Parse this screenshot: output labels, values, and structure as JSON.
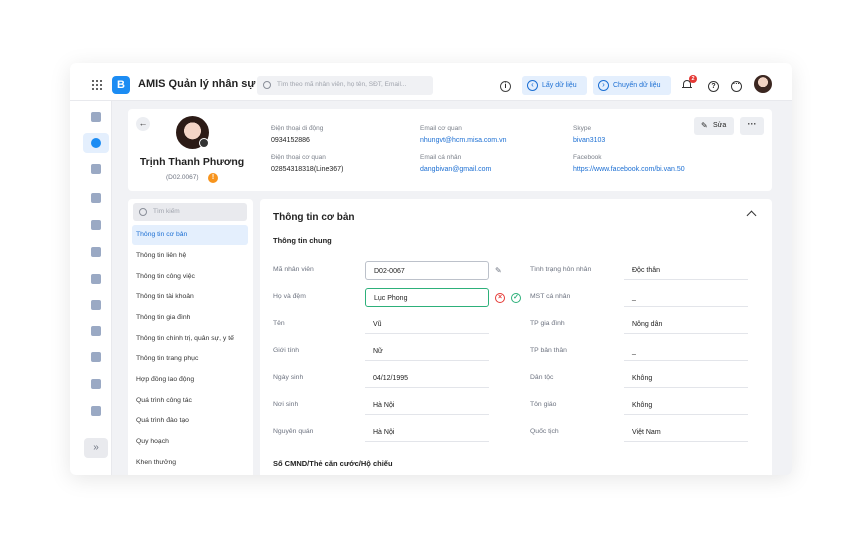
{
  "app": {
    "title": "AMIS Quản lý nhân sự",
    "logo_letter": "B",
    "search_placeholder": "Tìm theo mã nhân viên, họ tên, SĐT, Email...",
    "get_data_label": "Lấy dữ liệu",
    "transfer_data_label": "Chuyển dữ liệu",
    "notification_count": "2",
    "accent_color": "#1c8cf3"
  },
  "rail": {
    "icons": [
      "home-icon",
      "employee-icon",
      "document-icon",
      "user-check-icon",
      "user-remove-icon",
      "transfer-icon",
      "user-add-icon",
      "gift-icon",
      "info-icon",
      "team-icon",
      "chart-icon",
      "settings-icon"
    ],
    "expand_glyph": "»"
  },
  "profile": {
    "name": "Trịnh Thanh Phương",
    "code": "(D02.0067)",
    "edit_label": "Sửa",
    "contacts": [
      {
        "label": "Điện thoại di động",
        "value": "0934152886"
      },
      {
        "label": "Điện thoại cơ quan",
        "value": "02854318318(Line367)"
      },
      {
        "label": "Email cơ quan",
        "value": "nhungvt@hcm.misa.com.vn"
      },
      {
        "label": "Email cá nhân",
        "value": "dangbivan@gmail.com"
      },
      {
        "label": "Skype",
        "value": "bivan3103"
      },
      {
        "label": "Facebook",
        "value": "https://www.facebook.com/bi.van.50"
      }
    ]
  },
  "menu": {
    "search_placeholder": "Tìm kiếm",
    "items": [
      "Thông tin cơ bản",
      "Thông tin liên hệ",
      "Thông tin công việc",
      "Thông tin tài khoản",
      "Thông tin gia đình",
      "Thông tin chính trị, quân sự, y tế",
      "Thông tin trang phục",
      "Hợp đồng lao động",
      "Quá trình công tác",
      "Quá trình đào tạo",
      "Quy hoạch",
      "Khen thưởng"
    ],
    "active_index": 0
  },
  "main": {
    "section_title": "Thông tin cơ bản",
    "group_title": "Thông tin chung",
    "next_group_title": "Số CMND/Thẻ căn cước/Hộ chiếu",
    "left_fields": [
      {
        "label": "Mã nhân viên",
        "value": "D02-0067"
      },
      {
        "label": "Họ và đệm",
        "value": "Lục Phong"
      },
      {
        "label": "Tên",
        "value": "Vũ"
      },
      {
        "label": "Giới tính",
        "value": "Nữ"
      },
      {
        "label": "Ngày sinh",
        "value": "04/12/1995"
      },
      {
        "label": "Nơi sinh",
        "value": "Hà Nội"
      },
      {
        "label": "Nguyên quán",
        "value": "Hà Nội"
      }
    ],
    "right_fields": [
      {
        "label": "Tình trạng hôn nhân",
        "value": "Độc thân"
      },
      {
        "label": "MST cá nhân",
        "value": "_"
      },
      {
        "label": "TP gia đình",
        "value": "Nông dân"
      },
      {
        "label": "TP bản thân",
        "value": "_"
      },
      {
        "label": "Dân tộc",
        "value": "Không"
      },
      {
        "label": "Tôn giáo",
        "value": "Không"
      },
      {
        "label": "Quốc tịch",
        "value": "Việt Nam"
      }
    ]
  }
}
